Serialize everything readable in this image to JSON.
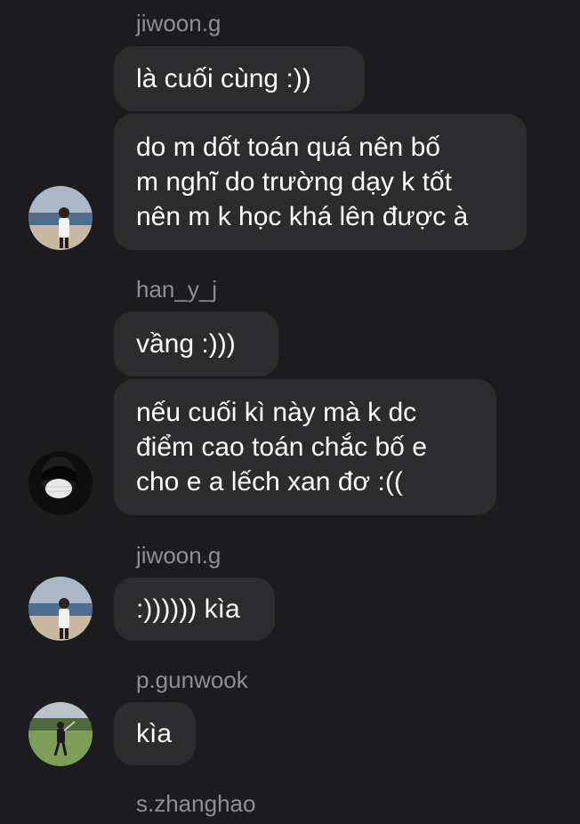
{
  "messages": [
    {
      "sender": "jiwoon.g",
      "lines": [
        "là cuối cùng :))"
      ]
    },
    {
      "lines": [
        "do m dốt toán quá nên bố",
        "m nghĩ do trường dạy k tốt",
        "nên m k học khá lên được à"
      ]
    },
    {
      "sender": "han_y_j",
      "lines": [
        "vầng :)))"
      ]
    },
    {
      "lines": [
        "nếu cuối kì này mà k dc",
        "điểm cao toán chắc bố e",
        "cho e a lếch xan đơ :(("
      ]
    },
    {
      "sender": "jiwoon.g",
      "lines": [
        ":)))))) kìa"
      ]
    },
    {
      "sender": "p.gunwook",
      "lines": [
        "kìa"
      ]
    },
    {
      "sender": "s.zhanghao"
    }
  ],
  "avatars": {
    "jiwoon": "beach-photo",
    "han": "masked-face-photo",
    "gunwook": "golf-course-photo"
  }
}
